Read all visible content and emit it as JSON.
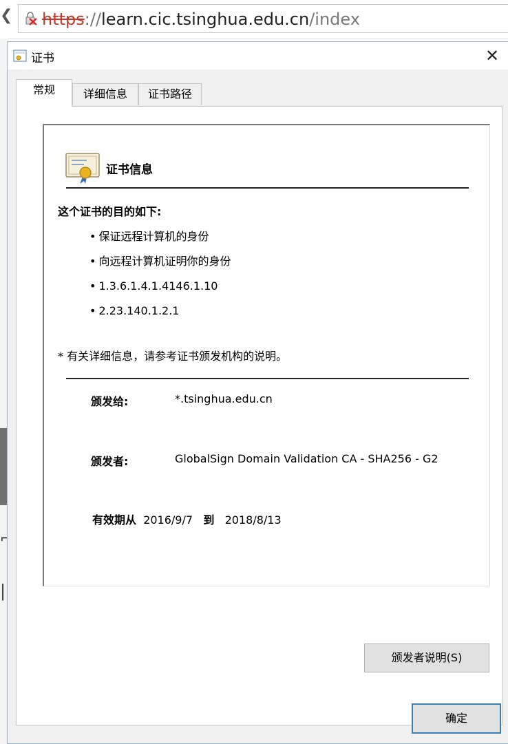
{
  "browser": {
    "address": {
      "protocol": "https",
      "separator": "://",
      "host": "learn.cic.tsinghua.edu.cn",
      "path": "/index"
    }
  },
  "dialog": {
    "title": "证书",
    "close_glyph": "✕",
    "tabs": [
      {
        "label": "常规",
        "active": true
      },
      {
        "label": "详细信息",
        "active": false
      },
      {
        "label": "证书路径",
        "active": false
      }
    ],
    "general": {
      "heading": "证书信息",
      "purpose_title": "这个证书的目的如下:",
      "purposes": [
        "保证远程计算机的身份",
        "向远程计算机证明你的身份",
        "1.3.6.1.4.1.4146.1.10",
        "2.23.140.1.2.1"
      ],
      "footnote": "* 有关详细信息，请参考证书颁发机构的说明。",
      "issued_to_label": "颁发给:",
      "issued_to_value": "*.tsinghua.edu.cn",
      "issued_by_label": "颁发者:",
      "issued_by_value": "GlobalSign Domain Validation CA - SHA256 - G2",
      "valid_from_label": "有效期从",
      "valid_from_value": "2016/9/7",
      "valid_to_label": "到",
      "valid_to_value": "2018/8/13",
      "issuer_statement_button": "颁发者说明(S)"
    },
    "ok_button": "确定"
  },
  "colors": {
    "accent_border": "#3c7fb1",
    "insecure_protocol": "#c0392b",
    "dialog_background": "#f0f0f0"
  },
  "icons": {
    "address": "certificate-error-lock-icon",
    "title": "certificate-icon",
    "heading": "certificate-ribbon-icon"
  }
}
